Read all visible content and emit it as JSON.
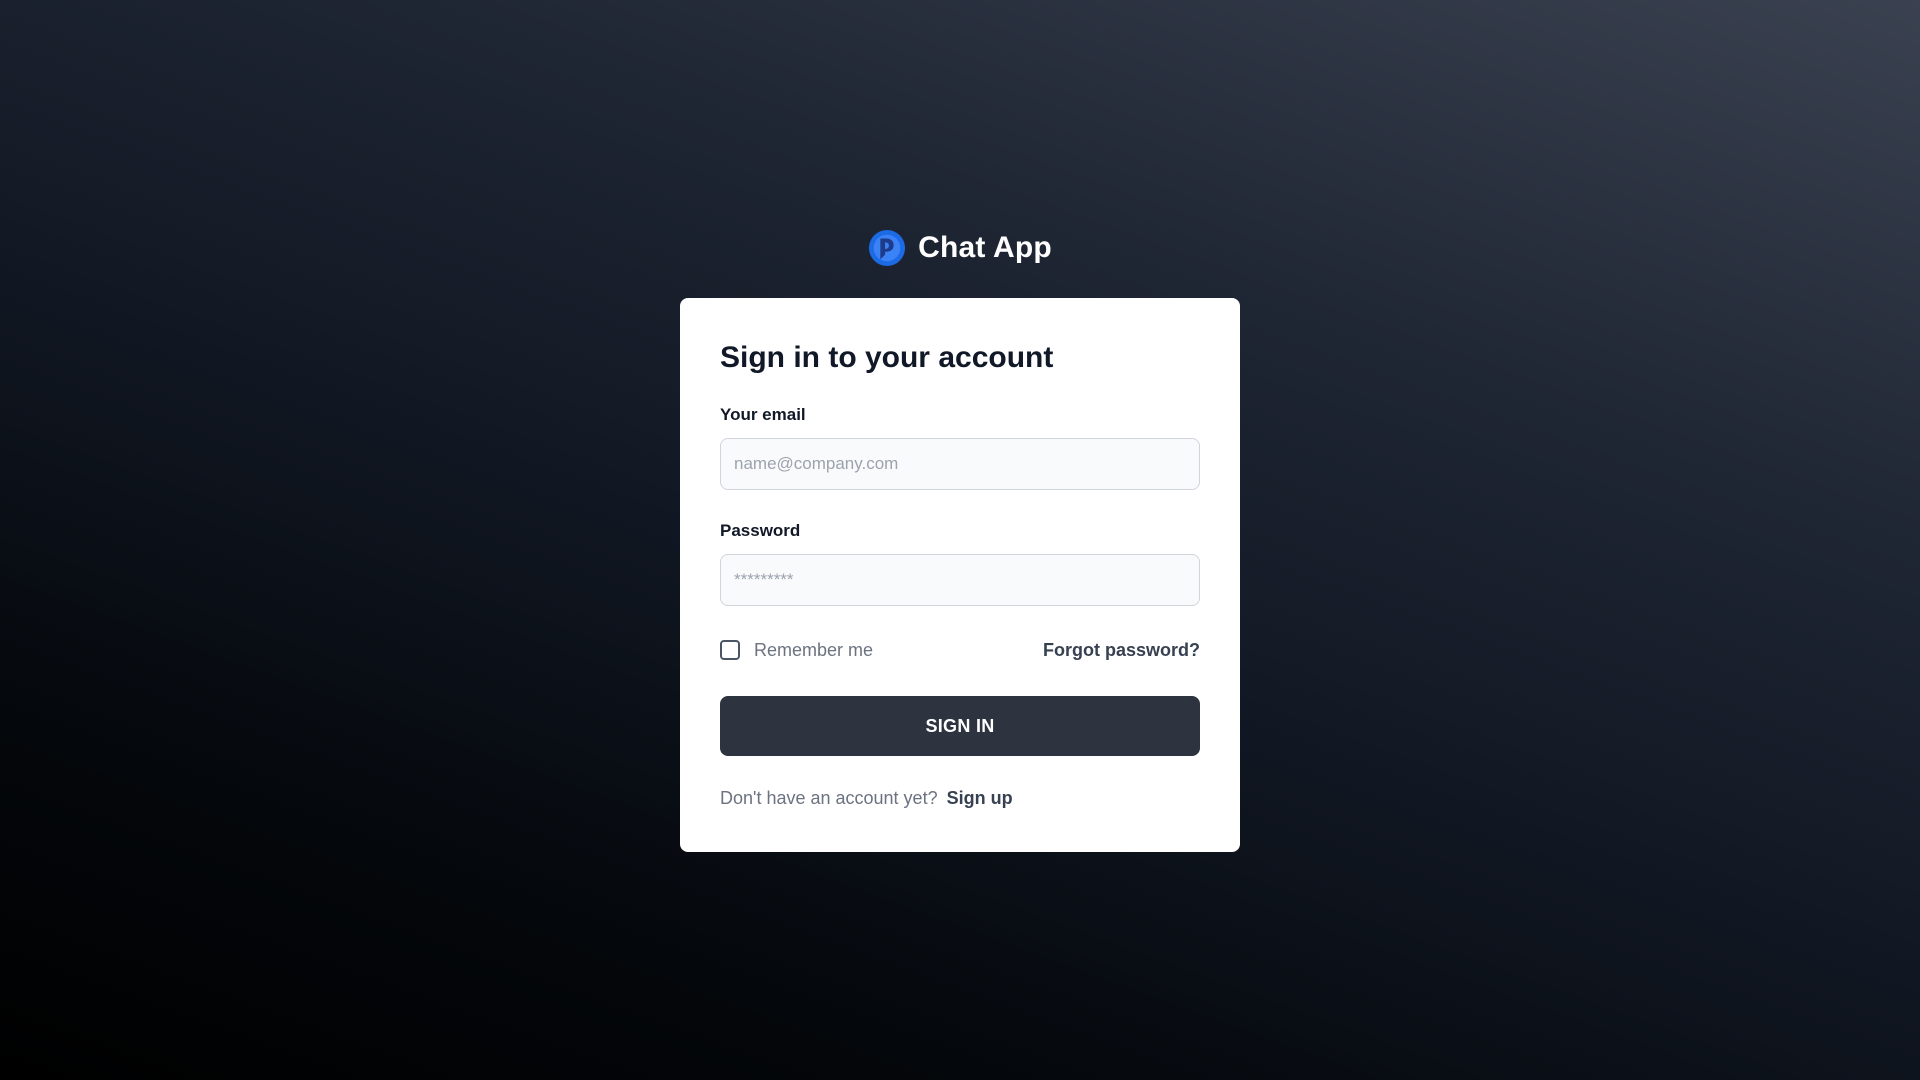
{
  "app": {
    "name": "Chat App",
    "logo_icon": "chat-app-logo-icon",
    "logo_colors": [
      "#1d6ae5",
      "#3b82f6",
      "#1e3a8a"
    ]
  },
  "form": {
    "title": "Sign in to your account",
    "email_label": "Your email",
    "email_placeholder": "name@company.com",
    "email_value": "",
    "password_label": "Password",
    "password_placeholder": "*********",
    "password_value": "",
    "remember_label": "Remember me",
    "remember_checked": false,
    "forgot_label": "Forgot password?",
    "submit_label": "SIGN IN",
    "signup_prompt": "Don't have an account yet?",
    "signup_label": "Sign up"
  },
  "colors": {
    "button_bg": "#2d3440",
    "card_bg": "#ffffff",
    "page_bg_light": "#3a4150",
    "page_bg_dark": "#000000"
  }
}
